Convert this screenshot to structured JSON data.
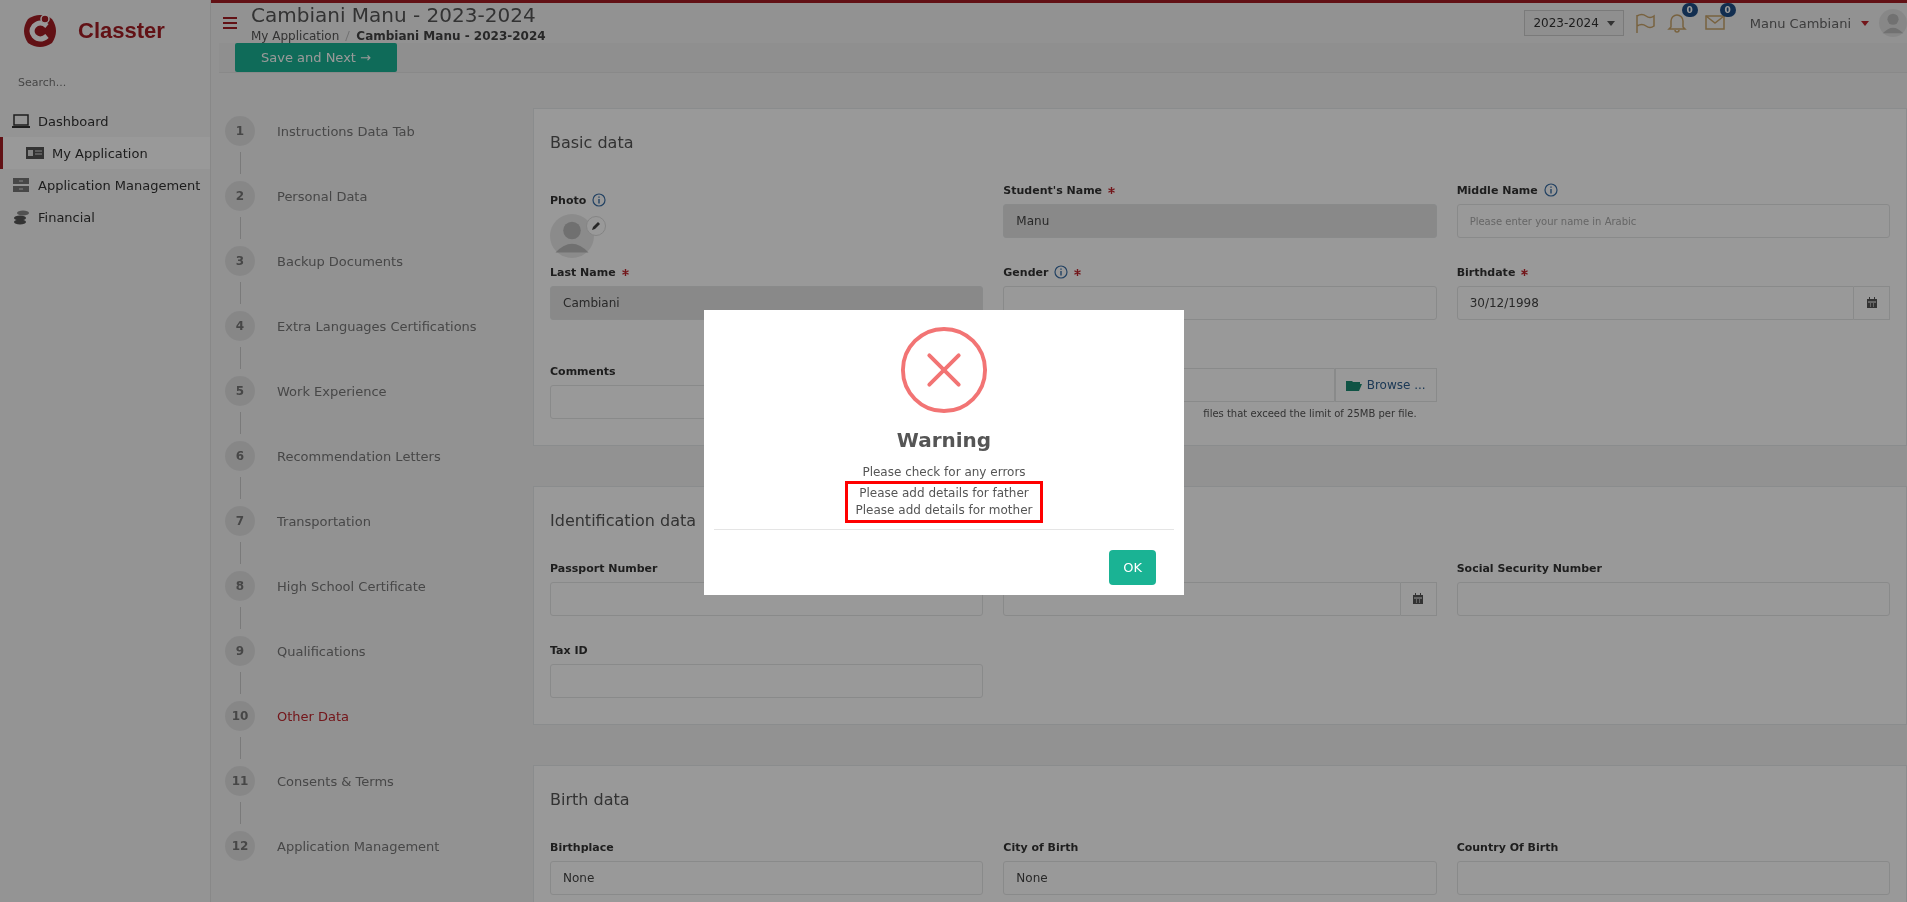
{
  "brand": {
    "name": "Classter"
  },
  "sidebar": {
    "search": {
      "placeholder": "Search..."
    },
    "items": [
      {
        "label": "Dashboard",
        "kind": "laptop",
        "selected": false
      },
      {
        "label": "My Application",
        "kind": "card",
        "selected": true
      },
      {
        "label": "Application Management",
        "kind": "drawers",
        "selected": false
      },
      {
        "label": "Financial",
        "kind": "coins",
        "selected": false
      }
    ]
  },
  "header": {
    "title": "Cambiani Manu - 2023-2024",
    "breadcrumb": [
      "My Application",
      "Cambiani Manu - 2023-2024"
    ],
    "year_select": "2023-2024",
    "notifications_badge": "0",
    "messages_badge": "0",
    "user": "Manu Cambiani"
  },
  "toolbar": {
    "save_button": "Save and Next →"
  },
  "steps": [
    {
      "number": "1",
      "label": "Instructions Data Tab",
      "selected": false
    },
    {
      "number": "2",
      "label": "Personal Data",
      "selected": false
    },
    {
      "number": "3",
      "label": "Backup Documents",
      "selected": false
    },
    {
      "number": "4",
      "label": "Extra Languages Certifications",
      "selected": false
    },
    {
      "number": "5",
      "label": "Work Experience",
      "selected": false
    },
    {
      "number": "6",
      "label": "Recommendation Letters",
      "selected": false
    },
    {
      "number": "7",
      "label": "Transportation",
      "selected": false
    },
    {
      "number": "8",
      "label": "High School Certificate",
      "selected": false
    },
    {
      "number": "9",
      "label": "Qualifications",
      "selected": false
    },
    {
      "number": "10",
      "label": "Other Data",
      "selected": true
    },
    {
      "number": "11",
      "label": "Consents & Terms",
      "selected": false
    },
    {
      "number": "12",
      "label": "Application Management",
      "selected": false
    }
  ],
  "sections": [
    {
      "title": "Basic data",
      "fields": [
        {
          "kind": "photo",
          "label": "Photo",
          "info": true
        },
        {
          "kind": "text",
          "label": "Student's Name",
          "required": true,
          "value": "Manu",
          "disabled": true
        },
        {
          "kind": "text",
          "label": "Middle Name",
          "info": true,
          "placeholder": "Please enter your name in Arabic",
          "disabled": false
        },
        {
          "kind": "text",
          "label": "Last Name",
          "required": true,
          "value": "Cambiani",
          "disabled": true
        },
        {
          "kind": "select",
          "label": "Gender",
          "required": true,
          "info": true,
          "disabled": false
        },
        {
          "kind": "date",
          "label": "Birthdate",
          "required": true,
          "value": "30/12/1998",
          "disabled": false
        },
        {
          "kind": "text",
          "label": "Comments",
          "disabled": false
        },
        {
          "kind": "file",
          "button": "Browse ...",
          "hint": "files that exceed the limit of 25MB per file.",
          "disabled": false
        }
      ]
    },
    {
      "title": "Identification data",
      "fields": [
        {
          "kind": "text",
          "label": "Passport Number",
          "disabled": false
        },
        {
          "kind": "date",
          "disabled": false
        },
        {
          "kind": "text",
          "label": "Social Security Number",
          "disabled": false
        },
        {
          "kind": "text",
          "label": "Tax ID",
          "disabled": false
        }
      ]
    },
    {
      "title": "Birth data",
      "fields": [
        {
          "kind": "text",
          "label": "Birthplace",
          "value": "None",
          "disabled": false
        },
        {
          "kind": "text",
          "label": "City of Birth",
          "value": "None",
          "disabled": false
        },
        {
          "kind": "text",
          "label": "Country Of Birth",
          "disabled": false
        }
      ]
    }
  ],
  "dialog": {
    "title": "Warning",
    "messages": [
      {
        "text": "Please check for any errors",
        "highlighted": false
      },
      {
        "text": "Please add details for father",
        "highlighted": true
      },
      {
        "text": "Please add details for mother",
        "highlighted": true
      }
    ],
    "ok_button": "OK"
  }
}
